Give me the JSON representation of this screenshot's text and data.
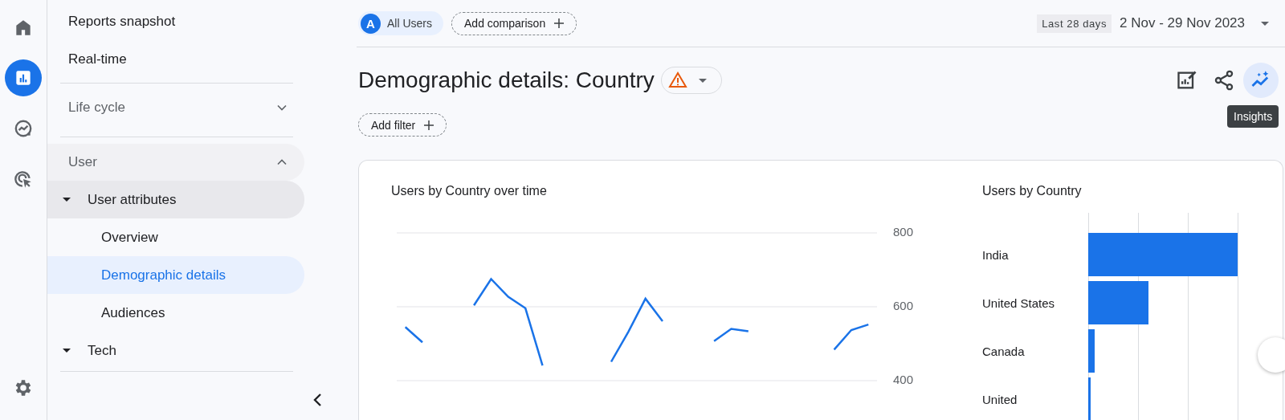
{
  "rail": {
    "items": [
      {
        "kind": "home",
        "selected": false
      },
      {
        "kind": "reports",
        "selected": true
      },
      {
        "kind": "explore",
        "selected": false
      },
      {
        "kind": "advertising",
        "selected": false
      }
    ],
    "bottom": [
      {
        "kind": "settings",
        "selected": false
      }
    ]
  },
  "nav": {
    "items": [
      {
        "kind": "link",
        "label": "Reports snapshot"
      },
      {
        "kind": "link",
        "label": "Real-time"
      },
      {
        "kind": "section",
        "label": "Life cycle",
        "expanded": false
      },
      {
        "kind": "section",
        "label": "User",
        "expanded": true,
        "children": [
          {
            "kind": "group",
            "label": "User attributes",
            "children": [
              {
                "label": "Overview",
                "selected": false
              },
              {
                "label": "Demographic details",
                "selected": true
              },
              {
                "label": "Audiences",
                "selected": false
              }
            ]
          },
          {
            "kind": "group",
            "label": "Tech"
          }
        ]
      }
    ]
  },
  "comparison": {
    "segments": [
      {
        "badge": "A",
        "label": "All Users"
      }
    ],
    "add_label": "Add comparison"
  },
  "date_range": {
    "preset": "Last 28 days",
    "range": "2 Nov - 29 Nov 2023"
  },
  "title": "Demographic details: Country",
  "add_filter": "Add filter",
  "tooltip": "Insights",
  "line_chart": {
    "title": "Users by Country over time",
    "chart_data": {
      "type": "line",
      "ylim": [
        400,
        800
      ],
      "yticks": [
        400,
        600,
        800
      ],
      "grid": true,
      "series": [
        {
          "color": "#1a73e8",
          "values": [
            545,
            504,
            null,
            null,
            604,
            675,
            627,
            596,
            441,
            null,
            null,
            null,
            451,
            532,
            622,
            561,
            null,
            null,
            507,
            540,
            534,
            null,
            null,
            null,
            null,
            484,
            537,
            552
          ]
        }
      ]
    }
  },
  "bar_chart": {
    "title": "Users by Country",
    "bars": [
      {
        "label": "India",
        "level": 0.99
      },
      {
        "label": "United States",
        "level": 0.4
      },
      {
        "label": "Canada",
        "level": 0.04
      },
      {
        "label": "United",
        "level": 0.015
      }
    ]
  }
}
